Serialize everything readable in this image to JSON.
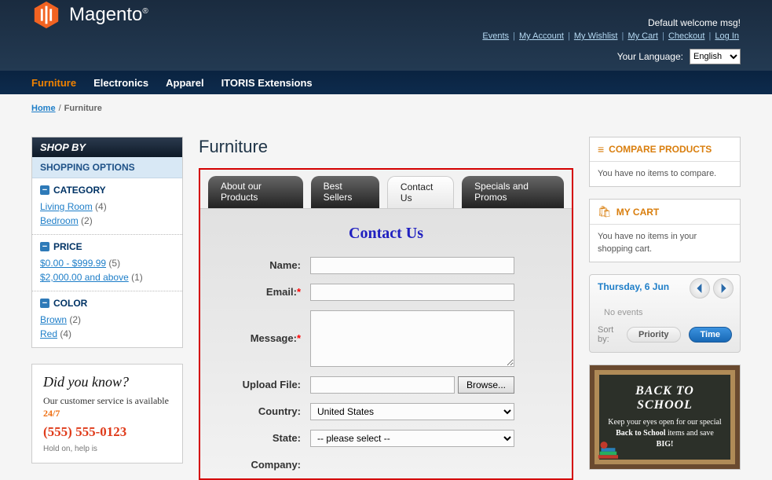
{
  "header": {
    "logo_text": "Magento",
    "welcome": "Default welcome msg!",
    "links": [
      "Events",
      "My Account",
      "My Wishlist",
      "My Cart",
      "Checkout",
      "Log In"
    ],
    "lang_label": "Your Language:",
    "lang_value": "English"
  },
  "nav": {
    "items": [
      "Furniture",
      "Electronics",
      "Apparel",
      "ITORIS Extensions"
    ],
    "active": "Furniture"
  },
  "breadcrumb": {
    "home": "Home",
    "current": "Furniture"
  },
  "shopby": {
    "title": "SHOP BY",
    "subtitle": "SHOPPING OPTIONS",
    "sections": [
      {
        "label": "CATEGORY",
        "items": [
          {
            "text": "Living Room",
            "count": "(4)"
          },
          {
            "text": "Bedroom",
            "count": "(2)"
          }
        ]
      },
      {
        "label": "PRICE",
        "items": [
          {
            "text": "$0.00 - $999.99",
            "count": "(5)"
          },
          {
            "text": "$2,000.00 and above",
            "count": "(1)"
          }
        ]
      },
      {
        "label": "COLOR",
        "items": [
          {
            "text": "Brown",
            "count": "(2)"
          },
          {
            "text": "Red",
            "count": "(4)"
          }
        ]
      }
    ]
  },
  "didyou": {
    "heading": "Did you know?",
    "sub1": "Our customer service is available ",
    "hours": "24/7",
    "phone": "(555) 555-0123",
    "hold": "Hold on, help is"
  },
  "main": {
    "title": "Furniture",
    "tabs": [
      "About our Products",
      "Best Sellers",
      "Contact Us",
      "Specials and Promos"
    ],
    "active_tab": "Contact Us",
    "contact_title": "Contact Us",
    "form": {
      "name_label": "Name:",
      "email_label": "Email:",
      "message_label": "Message:",
      "upload_label": "Upload File:",
      "browse_btn": "Browse...",
      "country_label": "Country:",
      "country_value": "United States",
      "state_label": "State:",
      "state_value": "-- please select --",
      "company_label": "Company:"
    }
  },
  "right": {
    "compare": {
      "title": "COMPARE PRODUCTS",
      "empty": "You have no items to compare."
    },
    "cart": {
      "title": "MY CART",
      "empty": "You have no items in your shopping cart."
    },
    "calendar": {
      "date": "Thursday, 6 Jun",
      "noevents": "No events",
      "sortby": "Sort by:",
      "priority": "Priority",
      "time": "Time"
    },
    "promo": {
      "heading": "BACK TO SCHOOL",
      "line1": "Keep your eyes open for our special ",
      "b1": "Back to School",
      "line2": " items and save ",
      "b2": "BIG!"
    }
  }
}
